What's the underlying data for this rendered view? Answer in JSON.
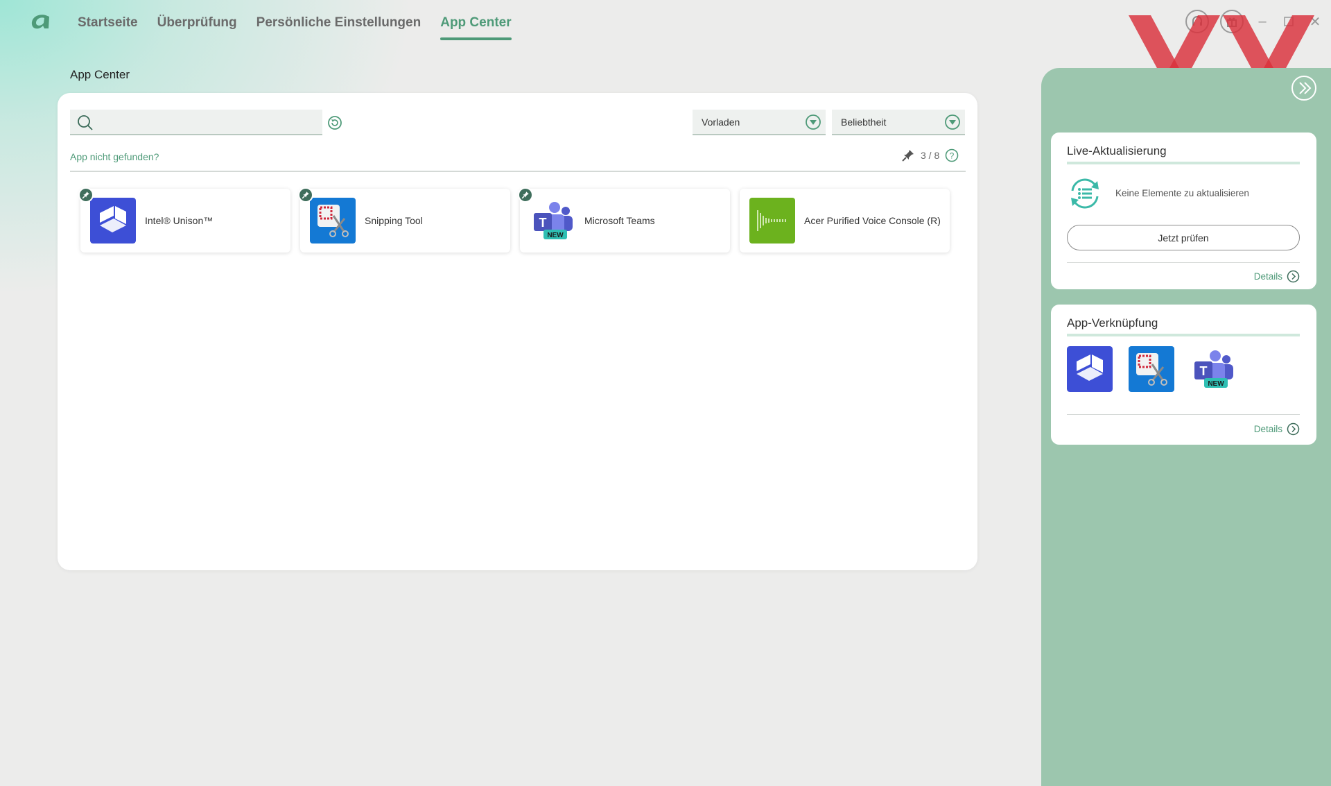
{
  "nav": {
    "tabs": [
      {
        "label": "Startseite",
        "active": false
      },
      {
        "label": "Überprüfung",
        "active": false
      },
      {
        "label": "Persönliche Einstellungen",
        "active": false
      },
      {
        "label": "App Center",
        "active": true
      }
    ]
  },
  "page": {
    "heading": "App Center"
  },
  "search": {
    "value": "",
    "placeholder": ""
  },
  "filters": {
    "preset": "Vorladen",
    "sort": "Beliebtheit"
  },
  "app_not_found_link": "App nicht gefunden?",
  "pin_counter": "3 / 8",
  "apps": [
    {
      "name": "Intel® Unison™",
      "pinned": true,
      "icon": "intel-unison-icon"
    },
    {
      "name": "Snipping Tool",
      "pinned": true,
      "icon": "snipping-tool-icon"
    },
    {
      "name": "Microsoft Teams",
      "pinned": true,
      "icon": "microsoft-teams-icon"
    },
    {
      "name": "Acer Purified Voice Console (R)",
      "pinned": false,
      "icon": "acer-purified-voice-icon"
    }
  ],
  "side_panel": {
    "live_update": {
      "title": "Live-Aktualisierung",
      "status": "Keine Elemente zu aktualisieren",
      "button": "Jetzt prüfen",
      "details": "Details"
    },
    "app_shortcuts": {
      "title": "App-Verknüpfung",
      "icons": [
        "intel-unison-icon",
        "snipping-tool-icon",
        "microsoft-teams-icon"
      ],
      "details": "Details"
    }
  },
  "colors": {
    "accent": "#4e9a78",
    "panel_bg": "#9cc6ae",
    "overlay_x": "#d9303a"
  }
}
